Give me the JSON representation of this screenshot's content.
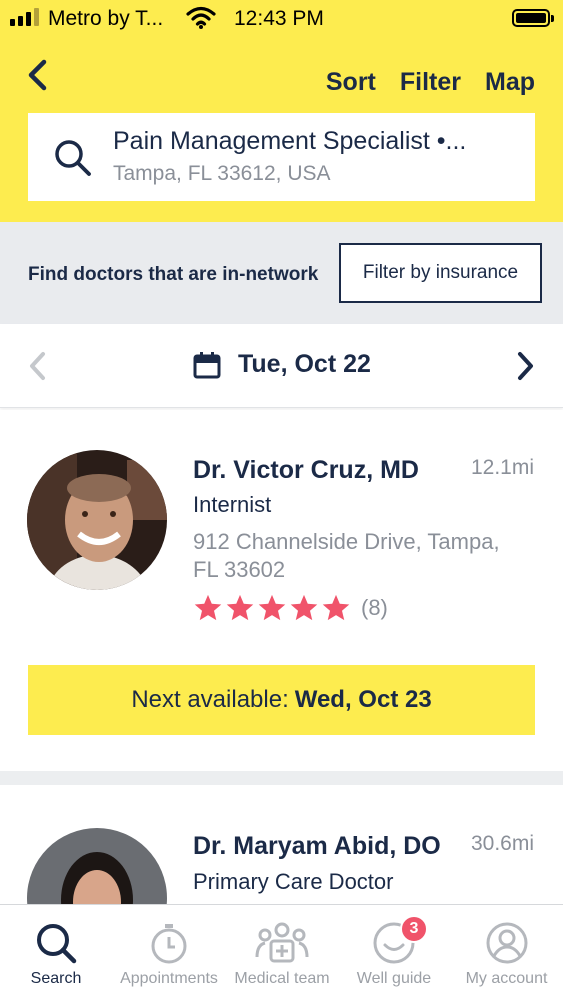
{
  "status_bar": {
    "carrier": "Metro by T...",
    "time": "12:43 PM"
  },
  "header": {
    "actions": {
      "sort": "Sort",
      "filter": "Filter",
      "map": "Map"
    },
    "search": {
      "query": "Pain Management Specialist •...",
      "location": "Tampa, FL 33612, USA"
    }
  },
  "insurance": {
    "prompt": "Find doctors that are in-network",
    "button": "Filter by insurance"
  },
  "date_nav": {
    "date": "Tue, Oct 22"
  },
  "doctors": [
    {
      "name": "Dr. Victor Cruz, MD",
      "distance": "12.1mi",
      "specialty": "Internist",
      "address_line1": "912 Channelside Drive, Tampa,",
      "address_line2": "FL 33602",
      "rating_stars": 5,
      "rating_count": "(8)",
      "next_available_label": "Next available:",
      "next_available_date": "Wed, Oct 23"
    },
    {
      "name": "Dr. Maryam Abid, DO",
      "distance": "30.6mi",
      "specialty": "Primary Care Doctor"
    }
  ],
  "tabs": [
    {
      "label": "Search",
      "icon": "search-icon",
      "active": true
    },
    {
      "label": "Appointments",
      "icon": "stopwatch-icon",
      "active": false
    },
    {
      "label": "Medical team",
      "icon": "medical-team-icon",
      "active": false
    },
    {
      "label": "Well guide",
      "icon": "smile-icon",
      "active": false,
      "badge": "3"
    },
    {
      "label": "My account",
      "icon": "user-icon",
      "active": false
    }
  ],
  "colors": {
    "brand_yellow": "#fdec4f",
    "navy": "#1b2a47",
    "star_pink": "#f0536a",
    "muted_gray": "#8a8f98"
  }
}
